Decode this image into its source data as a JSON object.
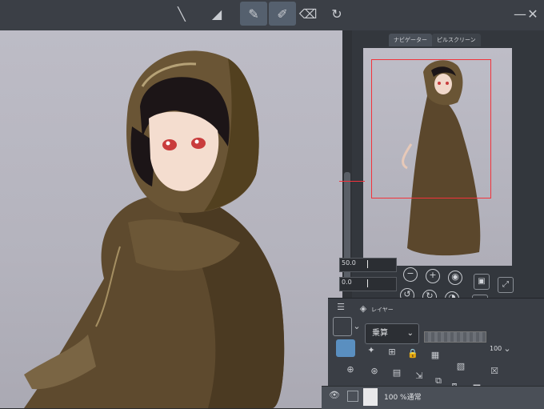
{
  "toolbar": {
    "tools": [
      "pen-tool-icon",
      "brush-tool-icon",
      "eraser-tool-icon",
      "rotate-tool-icon"
    ]
  },
  "navigator": {
    "tabs": [
      "ナビゲーター",
      "ピルスクリーン"
    ]
  },
  "sliders": {
    "zoom_value": "50.0",
    "rotate_value": "0.0"
  },
  "layers": {
    "tab_label": "レイヤー",
    "blend_mode": "乗算",
    "opacity": "100",
    "layer_name": "100 %通常"
  },
  "colors": {
    "cloak": "#5e4a2e",
    "accent_red": "#f2333b",
    "panel_bg": "#33373d"
  }
}
